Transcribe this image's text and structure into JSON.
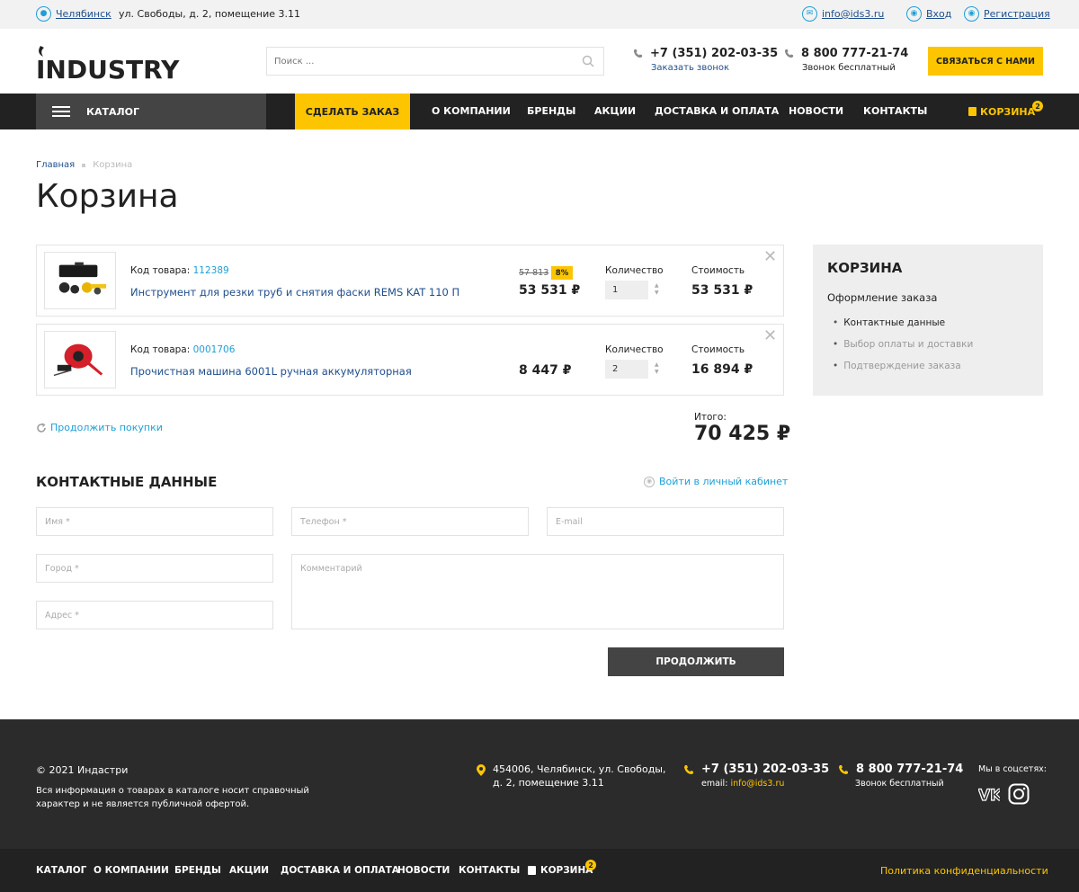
{
  "topbar": {
    "city": "Челябинск",
    "address": "ул. Свободы, д. 2, помещение 3.11",
    "email": "info@ids3.ru",
    "login": "Вход",
    "register": "Регистрация"
  },
  "header": {
    "logo_text": "INDUSTRY",
    "search_placeholder": "Поиск ...",
    "phone1": "+7 (351) 202-03-35",
    "phone1_sub": "Заказать звонок",
    "phone2": "8 800 777-21-74",
    "phone2_sub": "Звонок бесплатный",
    "cta": "СВЯЗАТЬСЯ С НАМИ"
  },
  "nav": {
    "catalog": "КАТАЛОГ",
    "order": "СДЕЛАТЬ ЗАКАЗ",
    "items": [
      "О КОМПАНИИ",
      "БРЕНДЫ",
      "АКЦИИ",
      "ДОСТАВКА И ОПЛАТА",
      "НОВОСТИ",
      "КОНТАКТЫ"
    ],
    "cart": "КОРЗИНА",
    "cart_count": "2"
  },
  "breadcrumb": {
    "home": "Главная",
    "current": "Корзина"
  },
  "page_title": "Корзина",
  "products": [
    {
      "code_label": "Код товара:",
      "code": "112389",
      "name": "Инструмент для резки труб и снятия фаски REMS KAT 110 П",
      "old_price": "57 813",
      "discount": "8%",
      "price": "53 531 ₽",
      "qty_label": "Количество",
      "qty": "1",
      "sum_label": "Стоимость",
      "sum": "53 531 ₽"
    },
    {
      "code_label": "Код товара:",
      "code": "0001706",
      "name": "Прочистная машина 6001L ручная аккумуляторная",
      "old_price": "",
      "discount": "",
      "price": "8 447 ₽",
      "qty_label": "Количество",
      "qty": "2",
      "sum_label": "Стоимость",
      "sum": "16 894 ₽"
    }
  ],
  "continue": "Продолжить покупки",
  "total": {
    "label": "Итого:",
    "value": "70 425 ₽"
  },
  "sidebar": {
    "title": "КОРЗИНА",
    "subtitle": "Оформление заказа",
    "steps": [
      "Контактные данные",
      "Выбор оплаты и доставки",
      "Подтверждение заказа"
    ]
  },
  "contact": {
    "title": "КОНТАКТНЫЕ ДАННЫЕ",
    "login_link": "Войти в личный кабинет",
    "name_ph": "Имя *",
    "phone_ph": "Телефон *",
    "email_ph": "E-mail",
    "city_ph": "Город *",
    "comment_ph": "Комментарий",
    "address_ph": "Адрес *",
    "submit": "ПРОДОЛЖИТЬ"
  },
  "footer": {
    "copyright": "© 2021 Индастри",
    "disclaimer": "Вся информация о товарах в каталоге носит справочный характер и не является публичной офертой.",
    "address_line1": "454006, Челябинск, ул. Свободы,",
    "address_line2": "д. 2, помещение 3.11",
    "phone1": "+7 (351) 202-03-35",
    "email_label": "email:",
    "email": "info@ids3.ru",
    "phone2": "8 800 777-21-74",
    "phone2_sub": "Звонок бесплатный",
    "social_label": "Мы в соцсетях:"
  },
  "bottom_nav": {
    "items": [
      "КАТАЛОГ",
      "О КОМПАНИИ",
      "БРЕНДЫ",
      "АКЦИИ",
      "ДОСТАВКА И ОПЛАТА",
      "НОВОСТИ",
      "КОНТАКТЫ"
    ],
    "cart": "КОРЗИНА",
    "cart_count": "2",
    "policy": "Политика конфиденциальности"
  },
  "colors": {
    "accent": "#fdc500",
    "link": "#1f4e8c",
    "link_light": "#1f9fd6",
    "dark": "#222222"
  }
}
